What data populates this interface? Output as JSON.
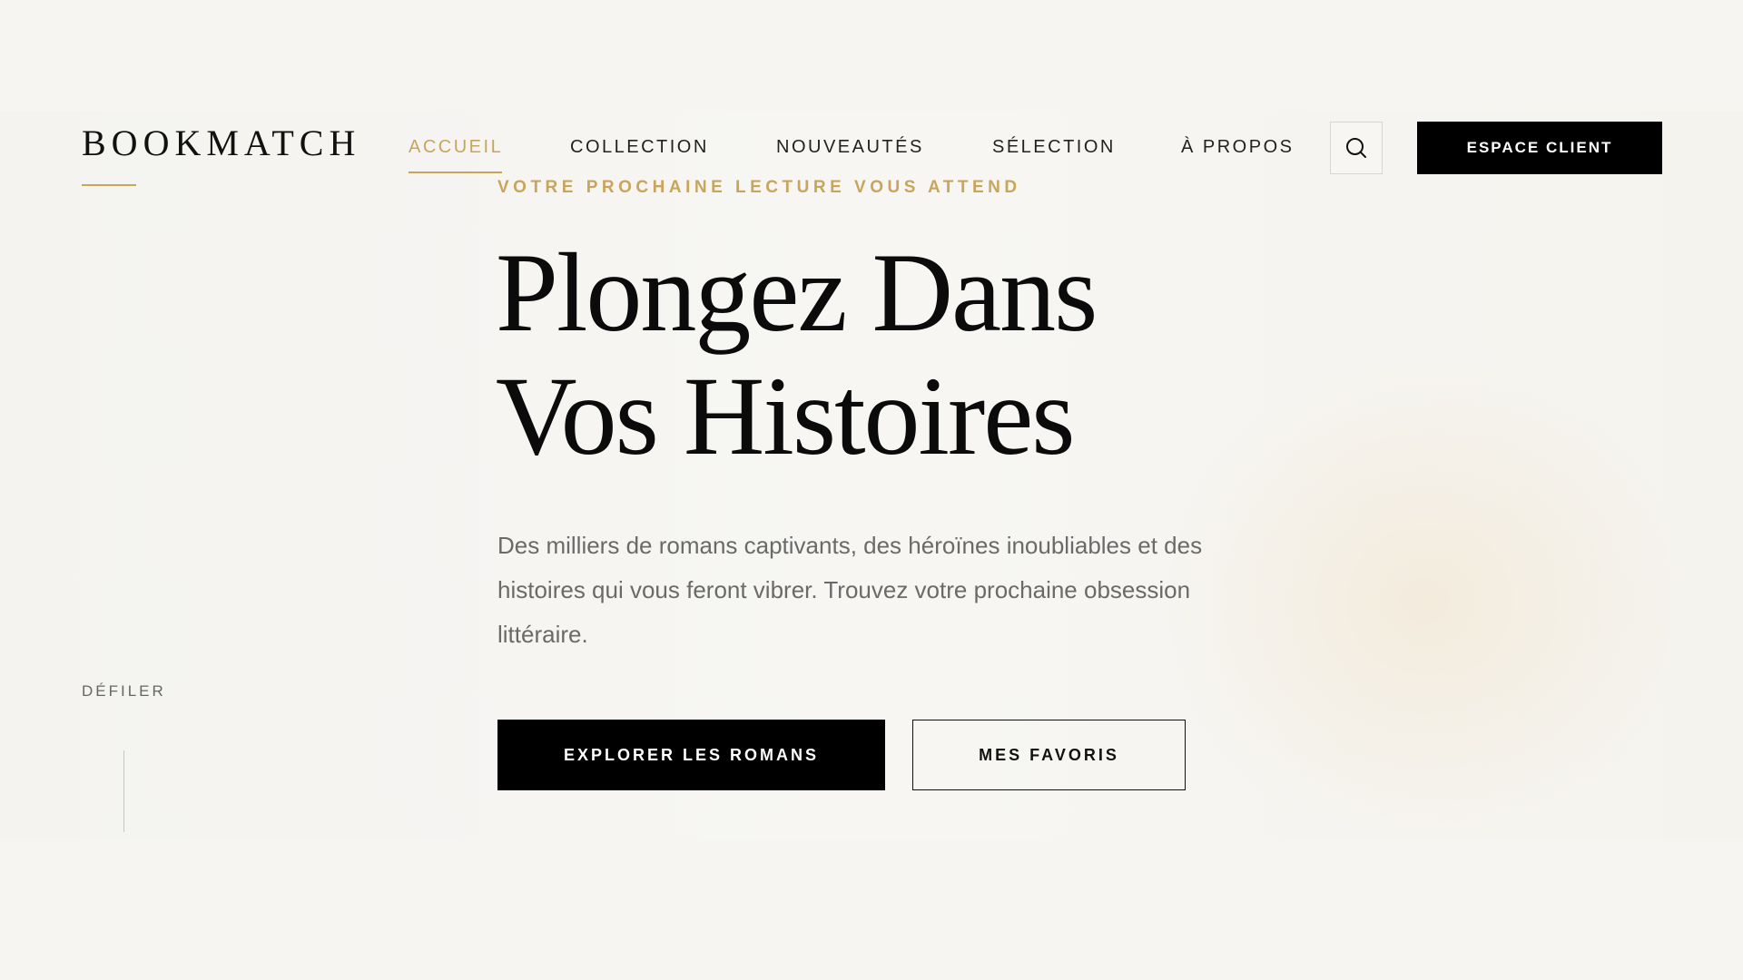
{
  "header": {
    "logo": "BOOKMATCH",
    "nav": [
      {
        "label": "ACCUEIL",
        "active": true
      },
      {
        "label": "COLLECTION",
        "active": false
      },
      {
        "label": "NOUVEAUTÉS",
        "active": false
      },
      {
        "label": "SÉLECTION",
        "active": false
      },
      {
        "label": "À PROPOS",
        "active": false
      }
    ],
    "search_icon": "search-icon",
    "client_button": "ESPACE CLIENT"
  },
  "hero": {
    "eyebrow": "VOTRE PROCHAINE LECTURE VOUS ATTEND",
    "headline_line1": "Plongez Dans",
    "headline_line2": "Vos Histoires",
    "subtitle": "Des milliers de romans captivants, des héroïnes inoubliables et des histoires qui vous feront vibrer. Trouvez votre prochaine obsession littéraire.",
    "primary_button": "EXPLORER LES ROMANS",
    "secondary_button": "MES FAVORIS"
  },
  "scroll": {
    "label": "DÉFILER"
  },
  "colors": {
    "accent": "#c9a55c",
    "background": "#f6f5f2",
    "text": "#111111",
    "muted": "#6a6a6a"
  }
}
